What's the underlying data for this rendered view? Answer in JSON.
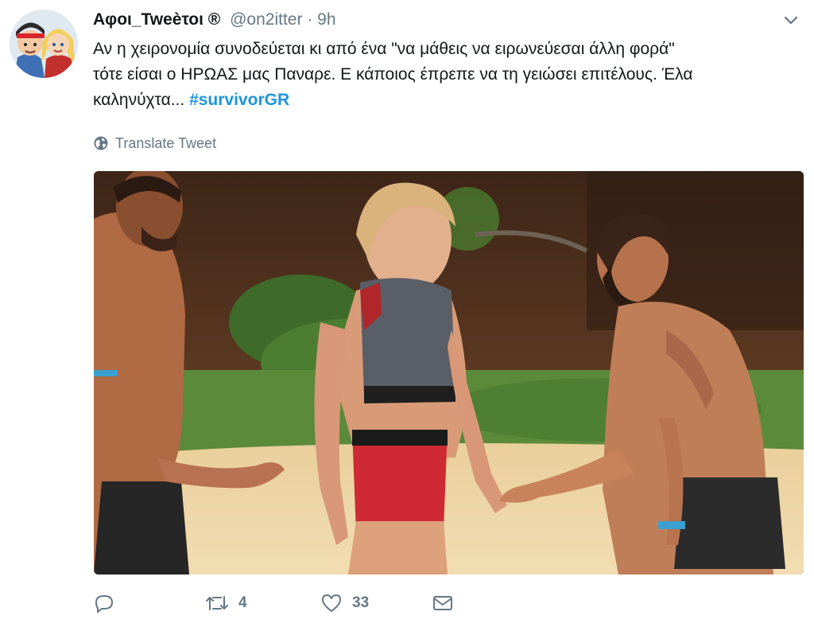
{
  "tweet": {
    "display_name": "Αφοι_Tweèτοι ®",
    "handle": "@on2itter",
    "separator": "·",
    "time": "9h",
    "text_lines": [
      "Αν η χειρονομία συνοδεύεται κι από ένα \"να μάθεις να ειρωνεύεσαι άλλη φορά\"",
      "τότε είσαι ο ΗΡΩΑΣ μας Παναρε. Ε κάποιος έπρεπε να τη γειώσει επιτέλους. Έλα"
    ],
    "text_last_line": "καληνύχτα... ",
    "hashtag": "#survivorGR",
    "translate_label": "Translate Tweet",
    "icons": {
      "avatar": "cartoon-avatar",
      "caret": "chevron-down-icon",
      "translate": "globe-icon",
      "reply": "reply-icon",
      "retweet": "retweet-icon",
      "like": "heart-icon",
      "dm": "envelope-icon"
    }
  },
  "actions": {
    "retweet_count": "4",
    "like_count": "33"
  },
  "colors": {
    "hashtag": "#1b95e0",
    "muted": "#657786",
    "text": "#14171a"
  }
}
